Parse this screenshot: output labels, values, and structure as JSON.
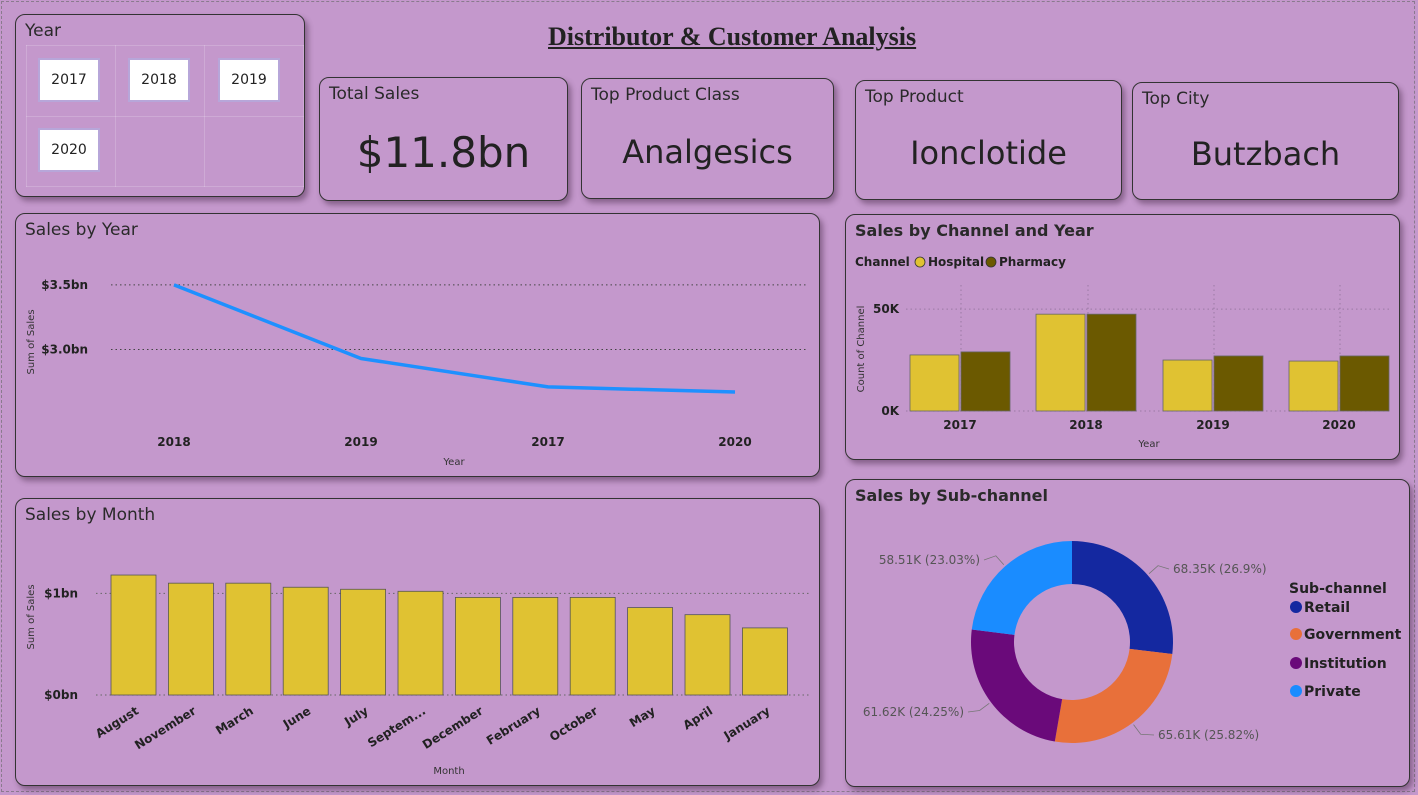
{
  "page": {
    "title": "Distributor & Customer Analysis"
  },
  "slicer": {
    "title": "Year",
    "options": [
      "2017",
      "2018",
      "2019",
      "2020"
    ]
  },
  "kpis": {
    "total_sales": {
      "label": "Total Sales",
      "value": "$11.8bn"
    },
    "top_product_class": {
      "label": "Top Product Class",
      "value": "Analgesics"
    },
    "top_product": {
      "label": "Top Product",
      "value": "Ionclotide"
    },
    "top_city": {
      "label": "Top City",
      "value": "Butzbach"
    }
  },
  "colors": {
    "line": "#1e90ff",
    "bar_month": "#e0c232",
    "hospital": "#e0c232",
    "pharmacy": "#6b5900",
    "retail": "#1428a0",
    "government": "#e8703a",
    "institution": "#6a0a7a",
    "private": "#1a8cff"
  },
  "chart_data": [
    {
      "type": "line",
      "title": "Sales by Year",
      "xlabel": "Year",
      "ylabel": "Sum of Sales",
      "x": [
        "2018",
        "2019",
        "2017",
        "2020"
      ],
      "values": [
        3.5,
        2.93,
        2.71,
        2.67
      ],
      "y_ticks": [
        {
          "value": 3.0,
          "label": "$3.0bn"
        },
        {
          "value": 3.5,
          "label": "$3.5bn"
        }
      ],
      "ylim": [
        2.5,
        3.6
      ],
      "grid": true
    },
    {
      "type": "bar",
      "title": "Sales by Month",
      "xlabel": "Month",
      "ylabel": "Sum of Sales",
      "categories": [
        "August",
        "November",
        "March",
        "June",
        "July",
        "Septem...",
        "December",
        "February",
        "October",
        "May",
        "April",
        "January"
      ],
      "values": [
        1.18,
        1.1,
        1.1,
        1.06,
        1.04,
        1.02,
        0.96,
        0.96,
        0.96,
        0.86,
        0.79,
        0.66
      ],
      "y_ticks": [
        {
          "value": 0,
          "label": "$0bn"
        },
        {
          "value": 1,
          "label": "$1bn"
        }
      ],
      "ylim": [
        0,
        1.2
      ],
      "grid": true
    },
    {
      "type": "bar",
      "title": "Sales by Channel and Year",
      "xlabel": "Year",
      "ylabel": "Count of Channel",
      "legend_title": "Channel",
      "categories": [
        "2017",
        "2018",
        "2019",
        "2020"
      ],
      "series": [
        {
          "name": "Hospital",
          "values": [
            27.5,
            47.5,
            25.0,
            24.5
          ]
        },
        {
          "name": "Pharmacy",
          "values": [
            29.0,
            47.5,
            27.0,
            27.0
          ]
        }
      ],
      "y_ticks": [
        {
          "value": 0,
          "label": "0K"
        },
        {
          "value": 50,
          "label": "50K"
        }
      ],
      "ylim": [
        0,
        52
      ],
      "legend_position": "top-left",
      "grid": true
    },
    {
      "type": "pie",
      "title": "Sales by Sub-channel",
      "legend_title": "Sub-channel",
      "legend_position": "right",
      "slices": [
        {
          "name": "Retail",
          "value": 68.35,
          "label": "68.35K (26.9%)"
        },
        {
          "name": "Government",
          "value": 65.61,
          "label": "65.61K (25.82%)"
        },
        {
          "name": "Institution",
          "value": 61.62,
          "label": "61.62K (24.25%)"
        },
        {
          "name": "Private",
          "value": 58.51,
          "label": "58.51K (23.03%)"
        }
      ]
    }
  ]
}
